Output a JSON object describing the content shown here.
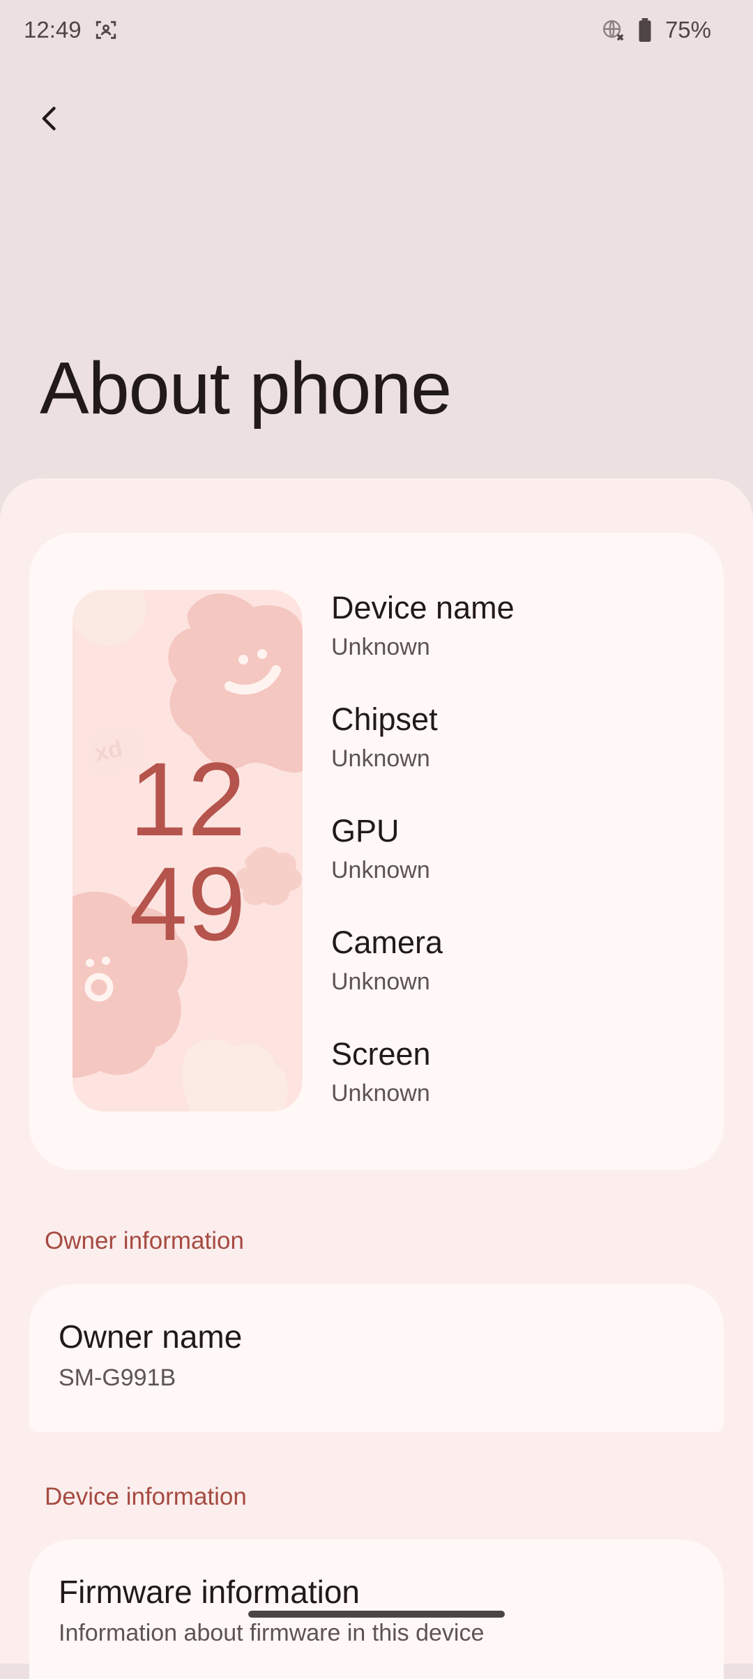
{
  "status": {
    "time": "12:49",
    "battery": "75%"
  },
  "page": {
    "title": "About phone"
  },
  "device_preview": {
    "clock_hour": "12",
    "clock_minute": "49",
    "watermark": "xd"
  },
  "device_specs": [
    {
      "label": "Device name",
      "value": "Unknown"
    },
    {
      "label": "Chipset",
      "value": "Unknown"
    },
    {
      "label": "GPU",
      "value": "Unknown"
    },
    {
      "label": "Camera",
      "value": "Unknown"
    },
    {
      "label": "Screen",
      "value": "Unknown"
    }
  ],
  "owner_section": {
    "header": "Owner information",
    "owner_name_label": "Owner name",
    "owner_name_value": "SM-G991B"
  },
  "device_section": {
    "header": "Device information",
    "firmware_label": "Firmware information",
    "firmware_summary": "Information about firmware in this device"
  },
  "colors": {
    "accent": "#a54a41",
    "background": "#ece0e0",
    "surface": "#fff8f7"
  },
  "icons": [
    "face-id-icon",
    "globe-off-icon",
    "battery-icon",
    "back-arrow-icon"
  ]
}
